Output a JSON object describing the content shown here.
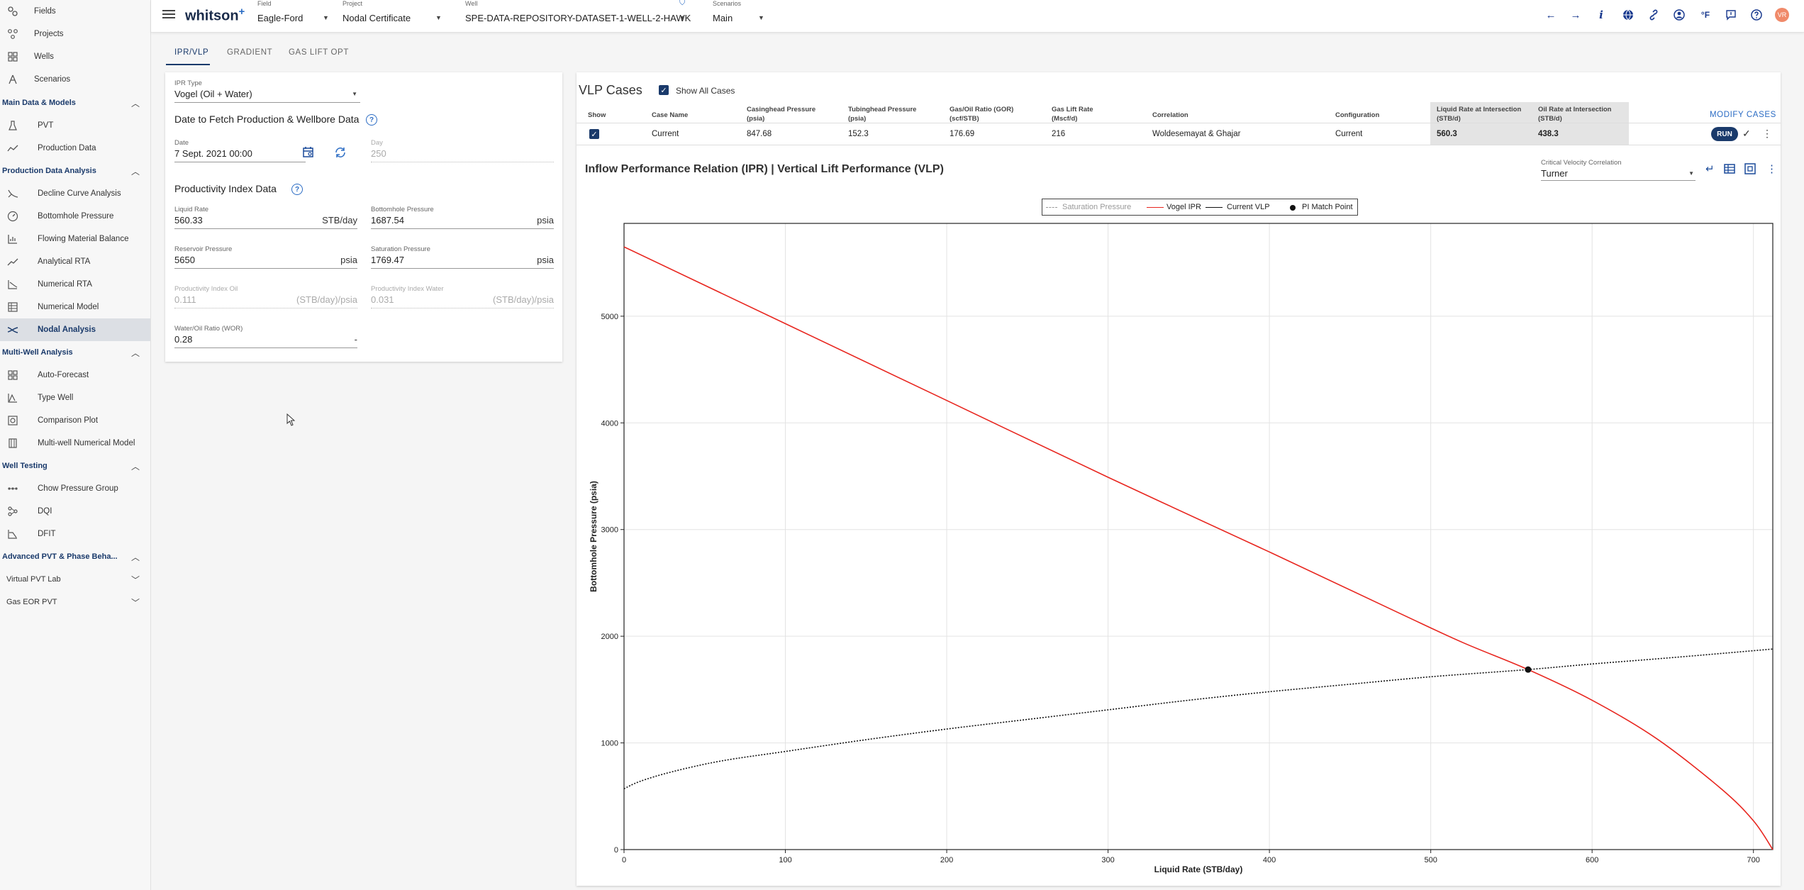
{
  "sidebar": {
    "top_items": [
      {
        "label": "Fields",
        "icon": "fields-icon"
      },
      {
        "label": "Projects",
        "icon": "projects-icon"
      },
      {
        "label": "Wells",
        "icon": "wells-icon"
      },
      {
        "label": "Scenarios",
        "icon": "scenarios-icon"
      }
    ],
    "sections": [
      {
        "label": "Main Data & Models",
        "items": [
          {
            "label": "PVT",
            "icon": "flask-icon"
          },
          {
            "label": "Production Data",
            "icon": "trend-icon"
          }
        ]
      },
      {
        "label": "Production Data Analysis",
        "items": [
          {
            "label": "Decline Curve Analysis",
            "icon": "decline-curve-icon"
          },
          {
            "label": "Bottomhole Pressure",
            "icon": "gauge-icon"
          },
          {
            "label": "Flowing Material Balance",
            "icon": "bars-icon"
          },
          {
            "label": "Analytical RTA",
            "icon": "line-chart-icon"
          },
          {
            "label": "Numerical RTA",
            "icon": "numerical-rta-icon"
          },
          {
            "label": "Numerical Model",
            "icon": "grid-model-icon"
          },
          {
            "label": "Nodal Analysis",
            "icon": "nodal-icon"
          }
        ]
      },
      {
        "label": "Multi-Well Analysis",
        "items": [
          {
            "label": "Auto-Forecast",
            "icon": "grid-icon"
          },
          {
            "label": "Type Well",
            "icon": "type-well-icon"
          },
          {
            "label": "Comparison Plot",
            "icon": "comparison-icon"
          },
          {
            "label": "Multi-well Numerical Model",
            "icon": "multi-well-icon"
          }
        ]
      },
      {
        "label": "Well Testing",
        "items": [
          {
            "label": "Chow Pressure Group",
            "icon": "chow-icon"
          },
          {
            "label": "DQI",
            "icon": "dqi-icon"
          },
          {
            "label": "DFIT",
            "icon": "dfit-icon"
          }
        ]
      }
    ],
    "advanced": {
      "label": "Advanced PVT & Phase Beha..."
    },
    "virtual_pvt": {
      "label": "Virtual PVT Lab"
    },
    "gas_eor": {
      "label": "Gas EOR PVT"
    }
  },
  "topbar": {
    "logo": "whitson",
    "logo_plus": "+",
    "field": {
      "caption": "Field",
      "value": "Eagle-Ford"
    },
    "project": {
      "caption": "Project",
      "value": "Nodal Certificate"
    },
    "well": {
      "caption": "Well",
      "value": "SPE-DATA-REPOSITORY-DATASET-1-WELL-2-HAWK"
    },
    "scenarios": {
      "caption": "Scenarios",
      "value": "Main"
    },
    "temp_unit": "°F",
    "avatar": "VR"
  },
  "tabs": [
    "IPR/VLP",
    "GRADIENT",
    "GAS LIFT OPT"
  ],
  "ipr": {
    "ipr_type": {
      "caption": "IPR Type",
      "value": "Vogel (Oil + Water)"
    },
    "date_section_title": "Date to Fetch Production & Wellbore Data",
    "date": {
      "caption": "Date",
      "value": "7 Sept. 2021 00:00"
    },
    "day": {
      "caption": "Day",
      "value": "250"
    },
    "pi_section_title": "Productivity Index Data",
    "liquid_rate": {
      "caption": "Liquid Rate",
      "value": "560.33",
      "unit": "STB/day"
    },
    "bottomhole_pressure": {
      "caption": "Bottomhole Pressure",
      "value": "1687.54",
      "unit": "psia"
    },
    "reservoir_pressure": {
      "caption": "Reservoir Pressure",
      "value": "5650",
      "unit": "psia"
    },
    "saturation_pressure": {
      "caption": "Saturation Pressure",
      "value": "1769.47",
      "unit": "psia"
    },
    "pi_oil": {
      "caption": "Productivity Index Oil",
      "value": "0.111",
      "unit": "(STB/day)/psia"
    },
    "pi_water": {
      "caption": "Productivity Index Water",
      "value": "0.031",
      "unit": "(STB/day)/psia"
    },
    "wor": {
      "caption": "Water/Oil Ratio (WOR)",
      "value": "0.28",
      "unit": "-"
    }
  },
  "vlp": {
    "title": "VLP Cases",
    "show_all_label": "Show All Cases",
    "modify_label": "MODIFY CASES",
    "columns": [
      [
        "Show"
      ],
      [
        "Case Name"
      ],
      [
        "Casinghead Pressure",
        "(psia)"
      ],
      [
        "Tubinghead Pressure",
        "(psia)"
      ],
      [
        "Gas/Oil Ratio (GOR)",
        "(scf/STB)"
      ],
      [
        "Gas Lift Rate",
        "(Mscf/d)"
      ],
      [
        "Correlation"
      ],
      [
        "Configuration"
      ],
      [
        "Liquid Rate at Intersection",
        "(STB/d)"
      ],
      [
        "Oil Rate at Intersection",
        "(STB/d)"
      ]
    ],
    "row": {
      "case_name": "Current",
      "casinghead": "847.68",
      "tubinghead": "152.3",
      "gor": "176.69",
      "gas_lift": "216",
      "correlation": "Woldesemayat & Ghajar",
      "configuration": "Current",
      "liquid_rate": "560.3",
      "oil_rate": "438.3",
      "run_label": "RUN"
    }
  },
  "chart": {
    "title": "Inflow Performance Relation (IPR) | Vertical Lift Performance (VLP)",
    "critical_velocity": {
      "caption": "Critical Velocity Correlation",
      "value": "Turner"
    }
  },
  "chart_data": {
    "type": "line",
    "xlabel": "Liquid Rate (STB/day)",
    "ylabel": "Bottomhole Pressure (psia)",
    "xlim": [
      0,
      712
    ],
    "ylim": [
      0,
      5870
    ],
    "xticks": [
      0,
      100,
      200,
      300,
      400,
      500,
      600,
      700
    ],
    "yticks": [
      0,
      1000,
      2000,
      3000,
      4000,
      5000
    ],
    "grid": true,
    "legend": "top-center",
    "legend_entries": [
      "Saturation Pressure",
      "Vogel IPR",
      "Current VLP",
      "PI Match Point"
    ],
    "colors": {
      "vogel_ipr": "#e8261f",
      "vlp": "#111111",
      "saturation": "#999999",
      "match": "#111111"
    },
    "series": [
      {
        "name": "Vogel IPR",
        "points": [
          [
            0,
            5650
          ],
          [
            100,
            4930
          ],
          [
            200,
            4210
          ],
          [
            300,
            3490
          ],
          [
            400,
            2790
          ],
          [
            480,
            2220
          ],
          [
            520,
            1940
          ],
          [
            560.33,
            1687.54
          ],
          [
            600,
            1400
          ],
          [
            640,
            1040
          ],
          [
            680,
            570
          ],
          [
            700,
            270
          ],
          [
            712,
            0
          ]
        ]
      },
      {
        "name": "Current VLP",
        "points": [
          [
            0,
            570
          ],
          [
            10,
            640
          ],
          [
            30,
            730
          ],
          [
            60,
            830
          ],
          [
            100,
            920
          ],
          [
            150,
            1030
          ],
          [
            200,
            1130
          ],
          [
            250,
            1220
          ],
          [
            300,
            1310
          ],
          [
            350,
            1400
          ],
          [
            400,
            1480
          ],
          [
            450,
            1550
          ],
          [
            500,
            1620
          ],
          [
            560.33,
            1687.54
          ],
          [
            600,
            1740
          ],
          [
            650,
            1800
          ],
          [
            712,
            1880
          ]
        ]
      }
    ],
    "pi_match_point": {
      "x": 560.33,
      "y": 1687.54
    }
  }
}
